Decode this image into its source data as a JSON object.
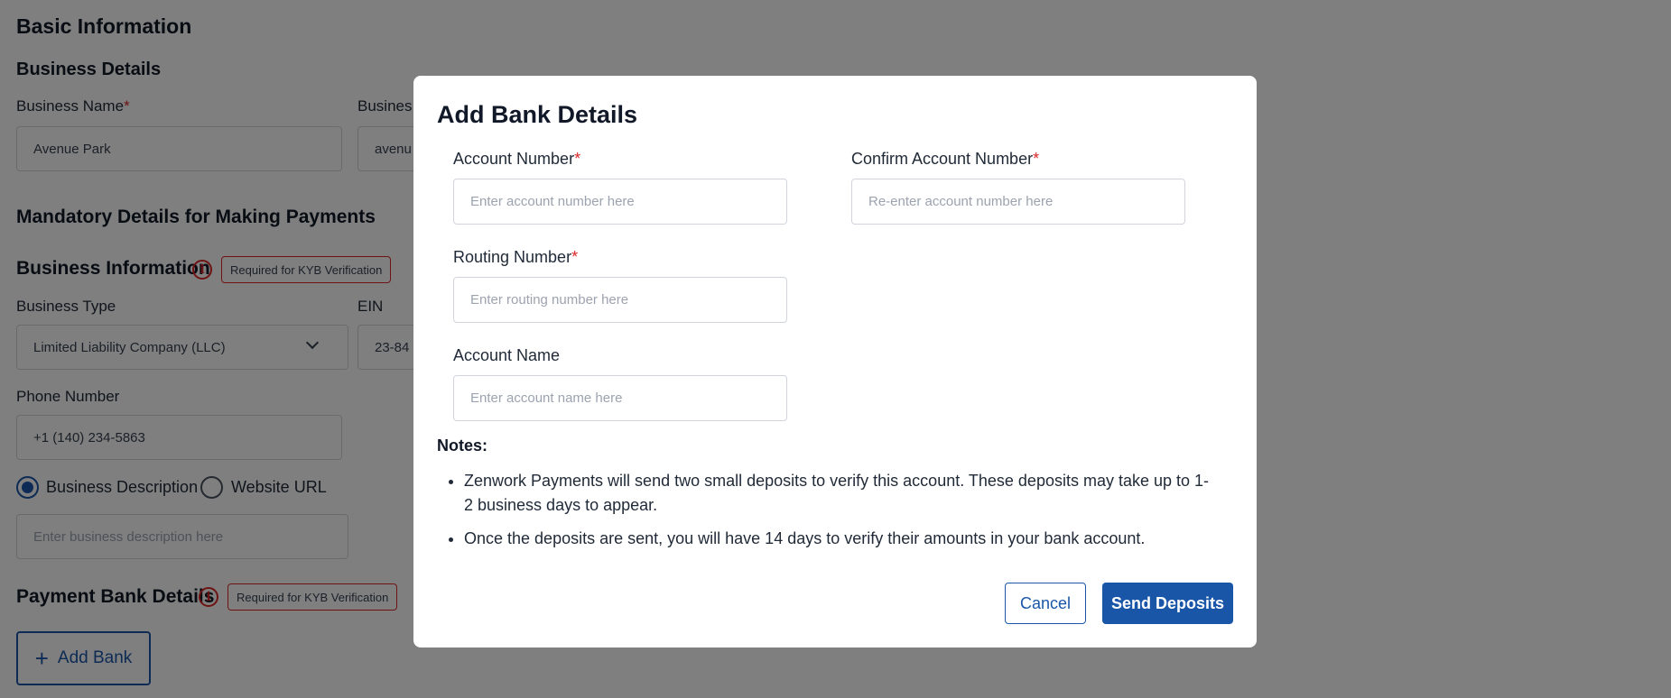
{
  "background": {
    "section_title": "Basic Information",
    "business_details_title": "Business Details",
    "business_name_label": "Business Name",
    "business_name_value": "Avenue Park",
    "business_dba_label": "Busines",
    "business_dba_value": "avenu",
    "mandatory_title": "Mandatory Details for Making Payments",
    "business_info_title": "Business Information",
    "kyb_badge": "Required for KYB Verification",
    "business_type_label": "Business Type",
    "business_type_value": "Limited Liability Company (LLC)",
    "ein_label": "EIN",
    "ein_value": "23-84",
    "phone_label": "Phone Number",
    "phone_value": "+1 (140) 234-5863",
    "radio_description_label": "Business Description",
    "radio_website_label": "Website URL",
    "description_placeholder": "Enter business description here",
    "payment_bank_title": "Payment Bank Details",
    "kyb_badge_2": "Required for KYB Verification",
    "add_bank_label": "Add Bank",
    "info_icon_glyph": "i"
  },
  "modal": {
    "title": "Add Bank Details",
    "required_mark": "*",
    "account_number_label": "Account Number",
    "account_number_placeholder": "Enter account number here",
    "confirm_account_label": "Confirm Account Number",
    "confirm_account_placeholder": "Re-enter account number here",
    "routing_label": "Routing Number",
    "routing_placeholder": "Enter routing number here",
    "account_name_label": "Account Name",
    "account_name_placeholder": "Enter account name here",
    "notes_title": "Notes:",
    "notes": [
      "Zenwork Payments will send two small deposits to verify this account. These deposits may take up to 1-2 business days to appear.",
      "Once the deposits are sent, you will have 14 days to verify their amounts in your bank account."
    ],
    "cancel_label": "Cancel",
    "send_label": "Send Deposits"
  },
  "colors": {
    "primary": "#1a56a8",
    "required": "#dc2626",
    "overlay": "rgba(0,0,0,0.5)"
  }
}
